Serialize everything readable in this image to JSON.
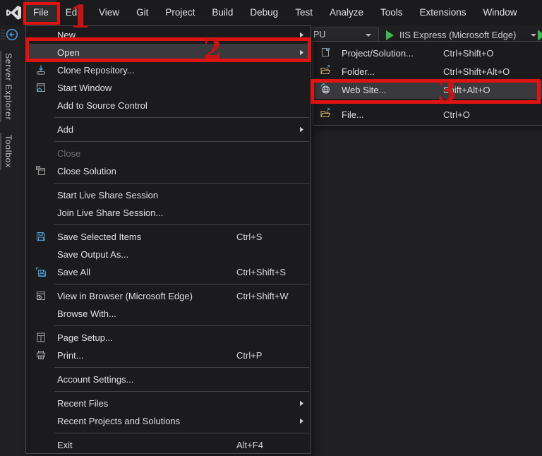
{
  "menubar": {
    "items": [
      "File",
      "Edit",
      "View",
      "Git",
      "Project",
      "Build",
      "Debug",
      "Test",
      "Analyze",
      "Tools",
      "Extensions",
      "Window"
    ]
  },
  "toolbar": {
    "platform_value": "PU",
    "run_button_label": "IIS Express (Microsoft Edge)"
  },
  "sidebar": {
    "tabs": [
      "Server Explorer",
      "Toolbox"
    ]
  },
  "file_menu": {
    "items": [
      {
        "label": "New",
        "submenu": true
      },
      {
        "label": "Open",
        "submenu": true,
        "highlighted": true
      },
      {
        "label": "Clone Repository...",
        "icon": "clone-repository-icon"
      },
      {
        "label": "Start Window",
        "icon": "start-window-icon"
      },
      {
        "label": "Add to Source Control"
      },
      {
        "separator": true
      },
      {
        "label": "Add",
        "submenu": true
      },
      {
        "separator": true
      },
      {
        "label": "Close",
        "disabled": true
      },
      {
        "label": "Close Solution",
        "icon": "close-solution-icon"
      },
      {
        "separator": true
      },
      {
        "label": "Start Live Share Session"
      },
      {
        "label": "Join Live Share Session..."
      },
      {
        "separator": true
      },
      {
        "label": "Save Selected Items",
        "icon": "save-icon",
        "shortcut": "Ctrl+S"
      },
      {
        "label": "Save Output As..."
      },
      {
        "label": "Save All",
        "icon": "save-all-icon",
        "shortcut": "Ctrl+Shift+S"
      },
      {
        "separator": true
      },
      {
        "label": "View in Browser (Microsoft Edge)",
        "icon": "view-in-browser-icon",
        "shortcut": "Ctrl+Shift+W"
      },
      {
        "label": "Browse With..."
      },
      {
        "separator": true
      },
      {
        "label": "Page Setup...",
        "icon": "page-setup-icon"
      },
      {
        "label": "Print...",
        "icon": "print-icon",
        "shortcut": "Ctrl+P"
      },
      {
        "separator": true
      },
      {
        "label": "Account Settings..."
      },
      {
        "separator": true
      },
      {
        "label": "Recent Files",
        "submenu": true
      },
      {
        "label": "Recent Projects and Solutions",
        "submenu": true
      },
      {
        "separator": true
      },
      {
        "label": "Exit",
        "shortcut": "Alt+F4"
      }
    ]
  },
  "open_submenu": {
    "items": [
      {
        "label": "Project/Solution...",
        "icon": "project-solution-icon",
        "shortcut": "Ctrl+Shift+O"
      },
      {
        "label": "Folder...",
        "icon": "open-folder-icon",
        "shortcut": "Ctrl+Shift+Alt+O"
      },
      {
        "label": "Web Site...",
        "icon": "web-site-icon",
        "shortcut": "Shift+Alt+O",
        "highlighted": true
      },
      {
        "separator": true
      },
      {
        "label": "File...",
        "icon": "open-file-icon",
        "shortcut": "Ctrl+O"
      }
    ]
  },
  "annotations": {
    "steps": [
      "1",
      "2",
      "3"
    ],
    "box_color": "#e01313",
    "number_color": "#c51414"
  },
  "colors": {
    "accent_blue": "#4ea0dc",
    "folder_yellow": "#cfa968",
    "run_green": "#3dbb52"
  }
}
